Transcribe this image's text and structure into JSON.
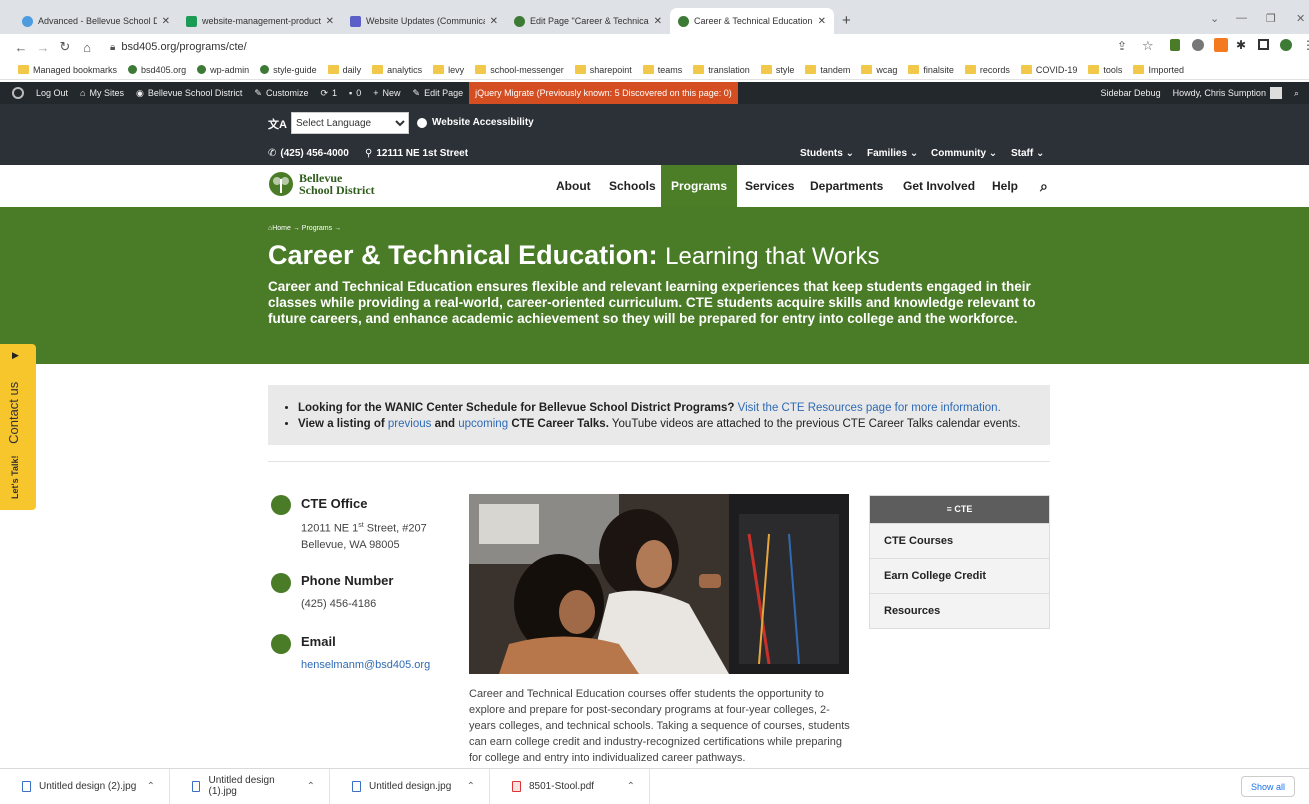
{
  "browser": {
    "tabs": [
      {
        "title": "Advanced - Bellevue School Distr",
        "color": "#4f9be0"
      },
      {
        "title": "website-management-productio",
        "color": "#1c9b54"
      },
      {
        "title": "Website Updates (Communicatio",
        "color": "#5b5fc7"
      },
      {
        "title": "Edit Page \"Career & Technical Ed",
        "color": "#3d7a35"
      },
      {
        "title": "Career & Technical Education – B",
        "color": "#3d7a35"
      }
    ],
    "new_tab": "+",
    "url": "bsd405.org/programs/cte/",
    "bookmarks": [
      "Managed bookmarks",
      "bsd405.org",
      "wp-admin",
      "style-guide",
      "daily",
      "analytics",
      "levy",
      "school-messenger",
      "sharepoint",
      "teams",
      "translation",
      "style",
      "tandem",
      "wcag",
      "finalsite",
      "records",
      "COVID-19",
      "tools",
      "Imported"
    ]
  },
  "adminbar": {
    "logout": "Log Out",
    "mysites": "My Sites",
    "site": "Bellevue School District",
    "customize": "Customize",
    "updates": "1",
    "comments": "0",
    "new": "New",
    "edit": "Edit Page",
    "jquery": "jQuery Migrate (Previously known: 5 Discovered on this page: 0)",
    "sidebar_debug": "Sidebar Debug",
    "howdy": "Howdy, Chris Sumption"
  },
  "topbar": {
    "language_select": "Select Language",
    "accessibility": "Website Accessibility",
    "phone": "(425) 456-4000",
    "address": "12111 NE 1st Street",
    "audience": [
      "Students",
      "Families",
      "Community",
      "Staff"
    ]
  },
  "logo": {
    "line1": "Bellevue",
    "line2": "School District"
  },
  "nav": [
    "About",
    "Schools",
    "Programs",
    "Services",
    "Departments",
    "Get Involved",
    "Help"
  ],
  "hero": {
    "breadcrumb": "Home → Programs →",
    "title_bold": "Career & Technical Education:",
    "title_light": "Learning that Works",
    "intro": "Career and Technical Education ensures flexible and relevant learning experiences that keep students engaged in their classes while providing a real-world, career-oriented curriculum. CTE students acquire skills and knowledge relevant to future careers, and enhance academic achievement so they will be prepared for entry into college and the workforce."
  },
  "notice": {
    "b1_bold": "Looking for the WANIC Center Schedule for Bellevue School District Programs?",
    "b1_link": "Visit the CTE Resources page for more information.",
    "b2_bold_a": "View a listing of",
    "b2_link_a": "previous",
    "b2_and": "and",
    "b2_link_b": "upcoming",
    "b2_bold_b": "CTE Career Talks.",
    "b2_rest": "YouTube videos are attached to the previous CTE Career Talks calendar events."
  },
  "contact": {
    "office_title": "CTE Office",
    "office_line1_a": "12011 NE 1",
    "office_line1_sup": "st",
    "office_line1_b": " Street, #207",
    "office_line2": "Bellevue, WA 98005",
    "phone_title": "Phone Number",
    "phone": "(425) 456-4186",
    "email_title": "Email",
    "email": "henselmanm@bsd405.org"
  },
  "body_text": "Career and Technical Education courses offer students the opportunity to explore and prepare for post-secondary programs at four-year colleges, 2-years colleges, and technical schools. Taking a sequence of courses, students can earn college credit and industry-recognized certifications while preparing for college and entry into individualized career pathways.",
  "sidemenu": {
    "header": "≡ CTE",
    "items": [
      "CTE Courses",
      "Earn College Credit",
      "Resources"
    ]
  },
  "contact_tab": {
    "label": "Contact us",
    "talk": "Let's Talk!"
  },
  "downloads": {
    "items": [
      "Untitled design (2).jpg",
      "Untitled design (1).jpg",
      "Untitled design.jpg",
      "8501-Stool.pdf"
    ],
    "show_all": "Show all"
  },
  "colors": {
    "brand_green": "#4a7b27",
    "link": "#2f6bb5",
    "dark": "#2c3137"
  }
}
